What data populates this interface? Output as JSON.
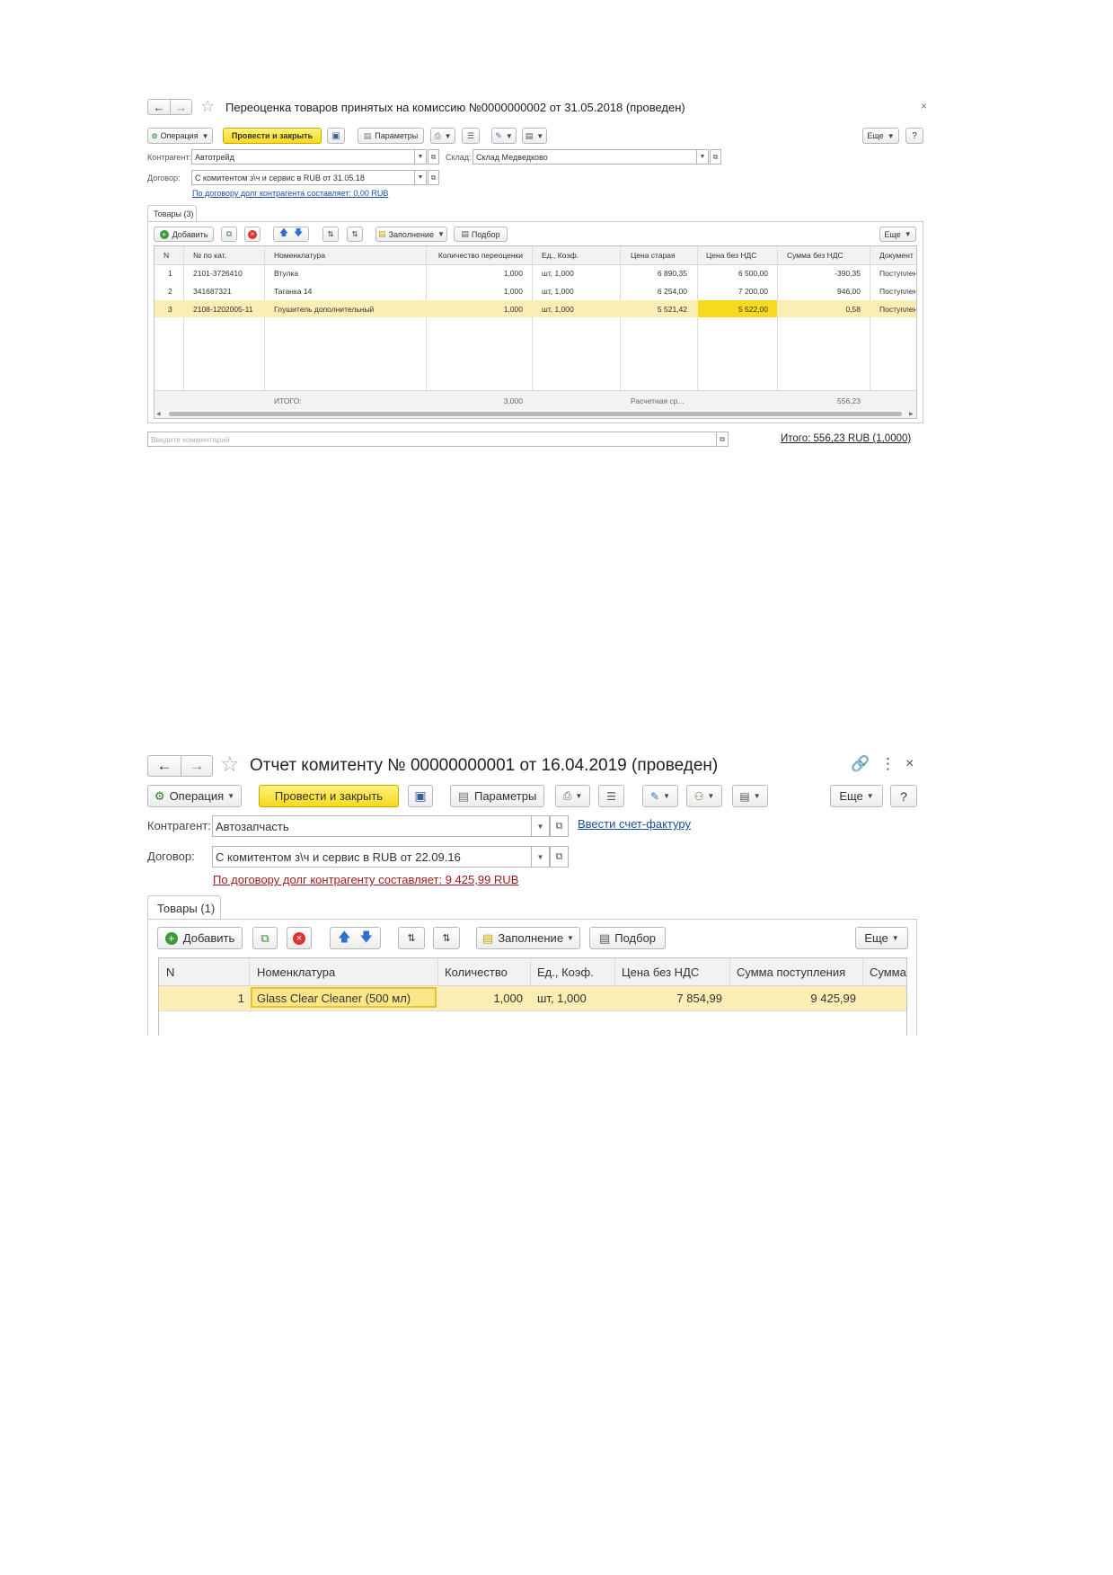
{
  "doc1": {
    "title": "Переоценка товаров принятых на комиссию №0000000002 от 31.05.2018 (проведен)",
    "toolbar": {
      "operation": "Операция",
      "post_close": "Провести и закрыть",
      "params": "Параметры",
      "more": "Еще",
      "help": "?"
    },
    "contractor_label": "Контрагент:",
    "contractor_value": "Автотрейд",
    "warehouse_label": "Склад:",
    "warehouse_value": "Склад Медведково",
    "contract_label": "Договор:",
    "contract_value": "С комитентом з\\ч и сервис в RUB от 31.05.18",
    "debt_link": "По договору долг контрагента составляет: 0,00 RUB",
    "tab": "Товары (3)",
    "table_toolbar": {
      "add": "Добавить",
      "fill": "Заполнение",
      "pick": "Подбор",
      "more": "Еще"
    },
    "columns": [
      "N",
      "№ по кат.",
      "Номенклатура",
      "Количество переоценки",
      "Ед., Коэф.",
      "Цена старая",
      "Цена без НДС",
      "Сумма без НДС",
      "Документ"
    ],
    "rows": [
      {
        "n": "1",
        "cat": "2101-3726410",
        "name": "Втулка",
        "qty": "1,000",
        "unit": "шт, 1,000",
        "old": "6 890,35",
        "price": "6 500,00",
        "sum": "-390,35",
        "doc": "Поступлен"
      },
      {
        "n": "2",
        "cat": "341687321",
        "name": "Таганка 14",
        "qty": "1,000",
        "unit": "шт, 1,000",
        "old": "6 254,00",
        "price": "7 200,00",
        "sum": "946,00",
        "doc": "Поступлен"
      },
      {
        "n": "3",
        "cat": "2108-1202005-11",
        "name": "Глушитель дополнительный",
        "qty": "1,000",
        "unit": "шт, 1,000",
        "old": "5 521,42",
        "price": "5 522,00",
        "sum": "0,58",
        "doc": "Поступлен"
      }
    ],
    "footer": {
      "label": "ИТОГО:",
      "qty": "3,000",
      "calc": "Расчетная ср...",
      "sum": "556,23"
    },
    "comment_placeholder": "Введите комментарий",
    "total": "Итого: 556,23 RUB (1,0000)"
  },
  "doc2": {
    "title": "Отчет комитенту № 00000000001 от 16.04.2019 (проведен)",
    "toolbar": {
      "operation": "Операция",
      "post_close": "Провести и закрыть",
      "params": "Параметры",
      "more": "Еще",
      "help": "?"
    },
    "contractor_label": "Контрагент:",
    "contractor_value": "Автозапчасть",
    "invoice_link": "Ввести счет-фактуру",
    "contract_label": "Договор:",
    "contract_value": "С комитентом з\\ч и сервис в RUB от 22.09.16",
    "debt_link": "По договору долг контрагенту составляет: 9 425,99 RUB",
    "tab": "Товары (1)",
    "table_toolbar": {
      "add": "Добавить",
      "fill": "Заполнение",
      "pick": "Подбор",
      "more": "Еще"
    },
    "columns": [
      "N",
      "Номенклатура",
      "Количество",
      "Ед., Коэф.",
      "Цена без НДС",
      "Сумма поступления",
      "Сумма"
    ],
    "rows": [
      {
        "n": "1",
        "name": "Glass Clear Cleaner (500 мл)",
        "qty": "1,000",
        "unit": "шт, 1,000",
        "price": "7 854,99",
        "sum": "9 425,99"
      }
    ]
  },
  "colors": {
    "accent_yellow": "#f7d91e",
    "row_highlight": "#fbeeb4",
    "link_blue": "#1a4f9c",
    "link_red": "#a01c1c"
  }
}
